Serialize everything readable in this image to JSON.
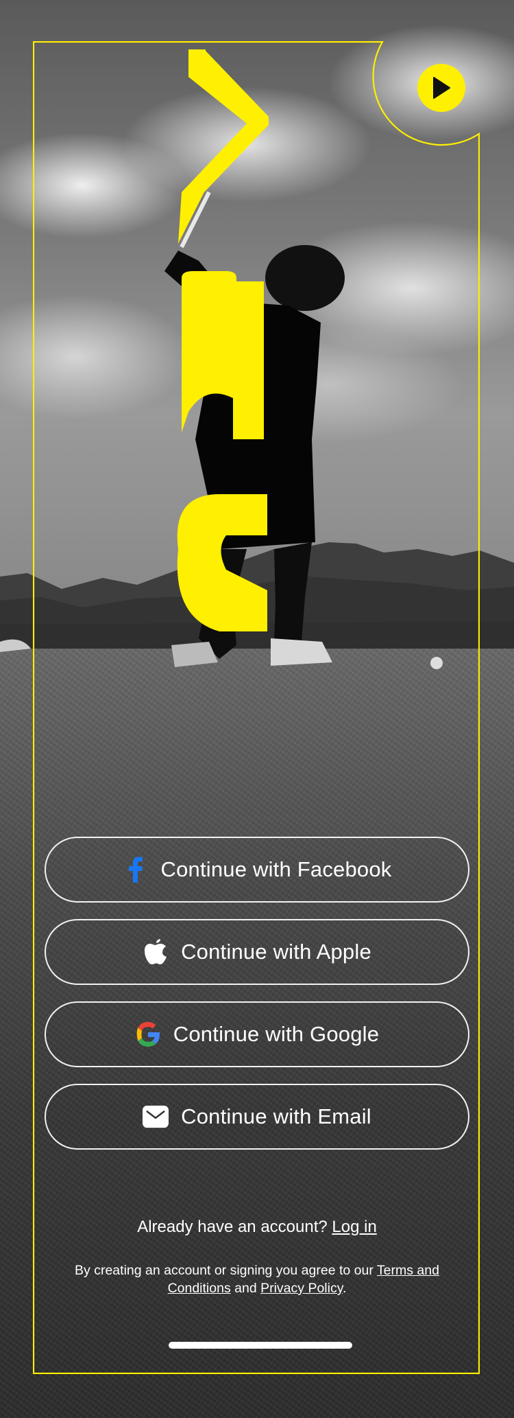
{
  "brand": {
    "logo_text": "CRV",
    "accent_color": "#ffef00"
  },
  "play_button": {
    "icon": "play-icon"
  },
  "auth_buttons": [
    {
      "label": "Continue with Facebook",
      "icon": "facebook-icon"
    },
    {
      "label": "Continue with Apple",
      "icon": "apple-icon"
    },
    {
      "label": "Continue with Google",
      "icon": "google-icon"
    },
    {
      "label": "Continue with Email",
      "icon": "email-icon"
    }
  ],
  "login": {
    "prompt": "Already have an account?",
    "link": "Log in"
  },
  "legal": {
    "prefix": "By creating an account or signing you agree to our",
    "terms_link": "Terms and Conditions",
    "conjunction": "and",
    "privacy_link": "Privacy Policy",
    "suffix": "."
  }
}
